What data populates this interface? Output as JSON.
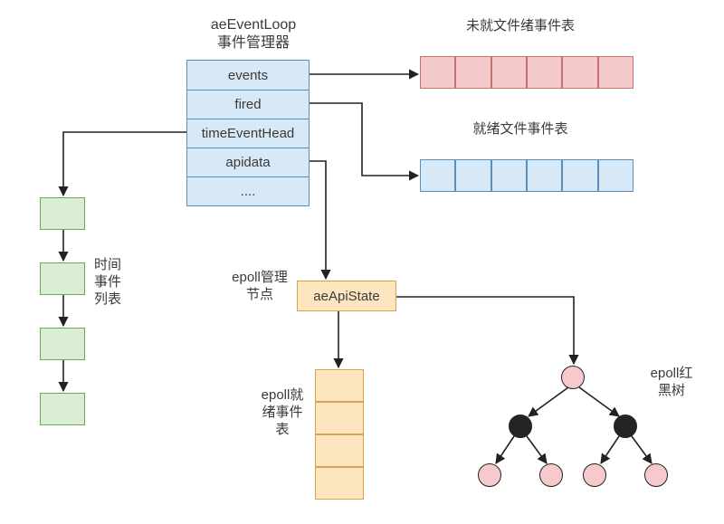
{
  "struct": {
    "title_en": "aeEventLoop",
    "title_zh": "事件管理器",
    "rows": [
      "events",
      "fired",
      "timeEventHead",
      "apidata",
      "...."
    ]
  },
  "labels": {
    "pending_file_table": "未就文件绪事件表",
    "ready_file_table": "就绪文件事件表",
    "time_event_list": "时间事件列表",
    "epoll_manager": "epoll管理节点",
    "epoll_ready_table": "epoll就绪事件表",
    "epoll_rbtree": "epoll红黑树",
    "api_state": "aeApiState"
  },
  "chart_data": {
    "type": "diagram",
    "description": "Redis aeEventLoop structure diagram",
    "aeEventLoop_fields": [
      "events",
      "fired",
      "timeEventHead",
      "apidata",
      "...."
    ],
    "events_points_to": "pending file event table (6 slots, unready)",
    "fired_points_to": "ready file event table (6 slots)",
    "timeEventHead_points_to": "time event linked list (4 nodes)",
    "apidata_points_to": "aeApiState (epoll manager node)",
    "aeApiState_points_to": [
      "epoll ready event table (4 slots)",
      "epoll red-black tree"
    ],
    "rbtree": {
      "root": {
        "color": "pink",
        "children": [
          {
            "color": "black",
            "children": [
              {
                "color": "pink"
              },
              {
                "color": "pink"
              }
            ]
          },
          {
            "color": "black",
            "children": [
              {
                "color": "pink"
              },
              {
                "color": "pink"
              }
            ]
          }
        ]
      }
    }
  }
}
